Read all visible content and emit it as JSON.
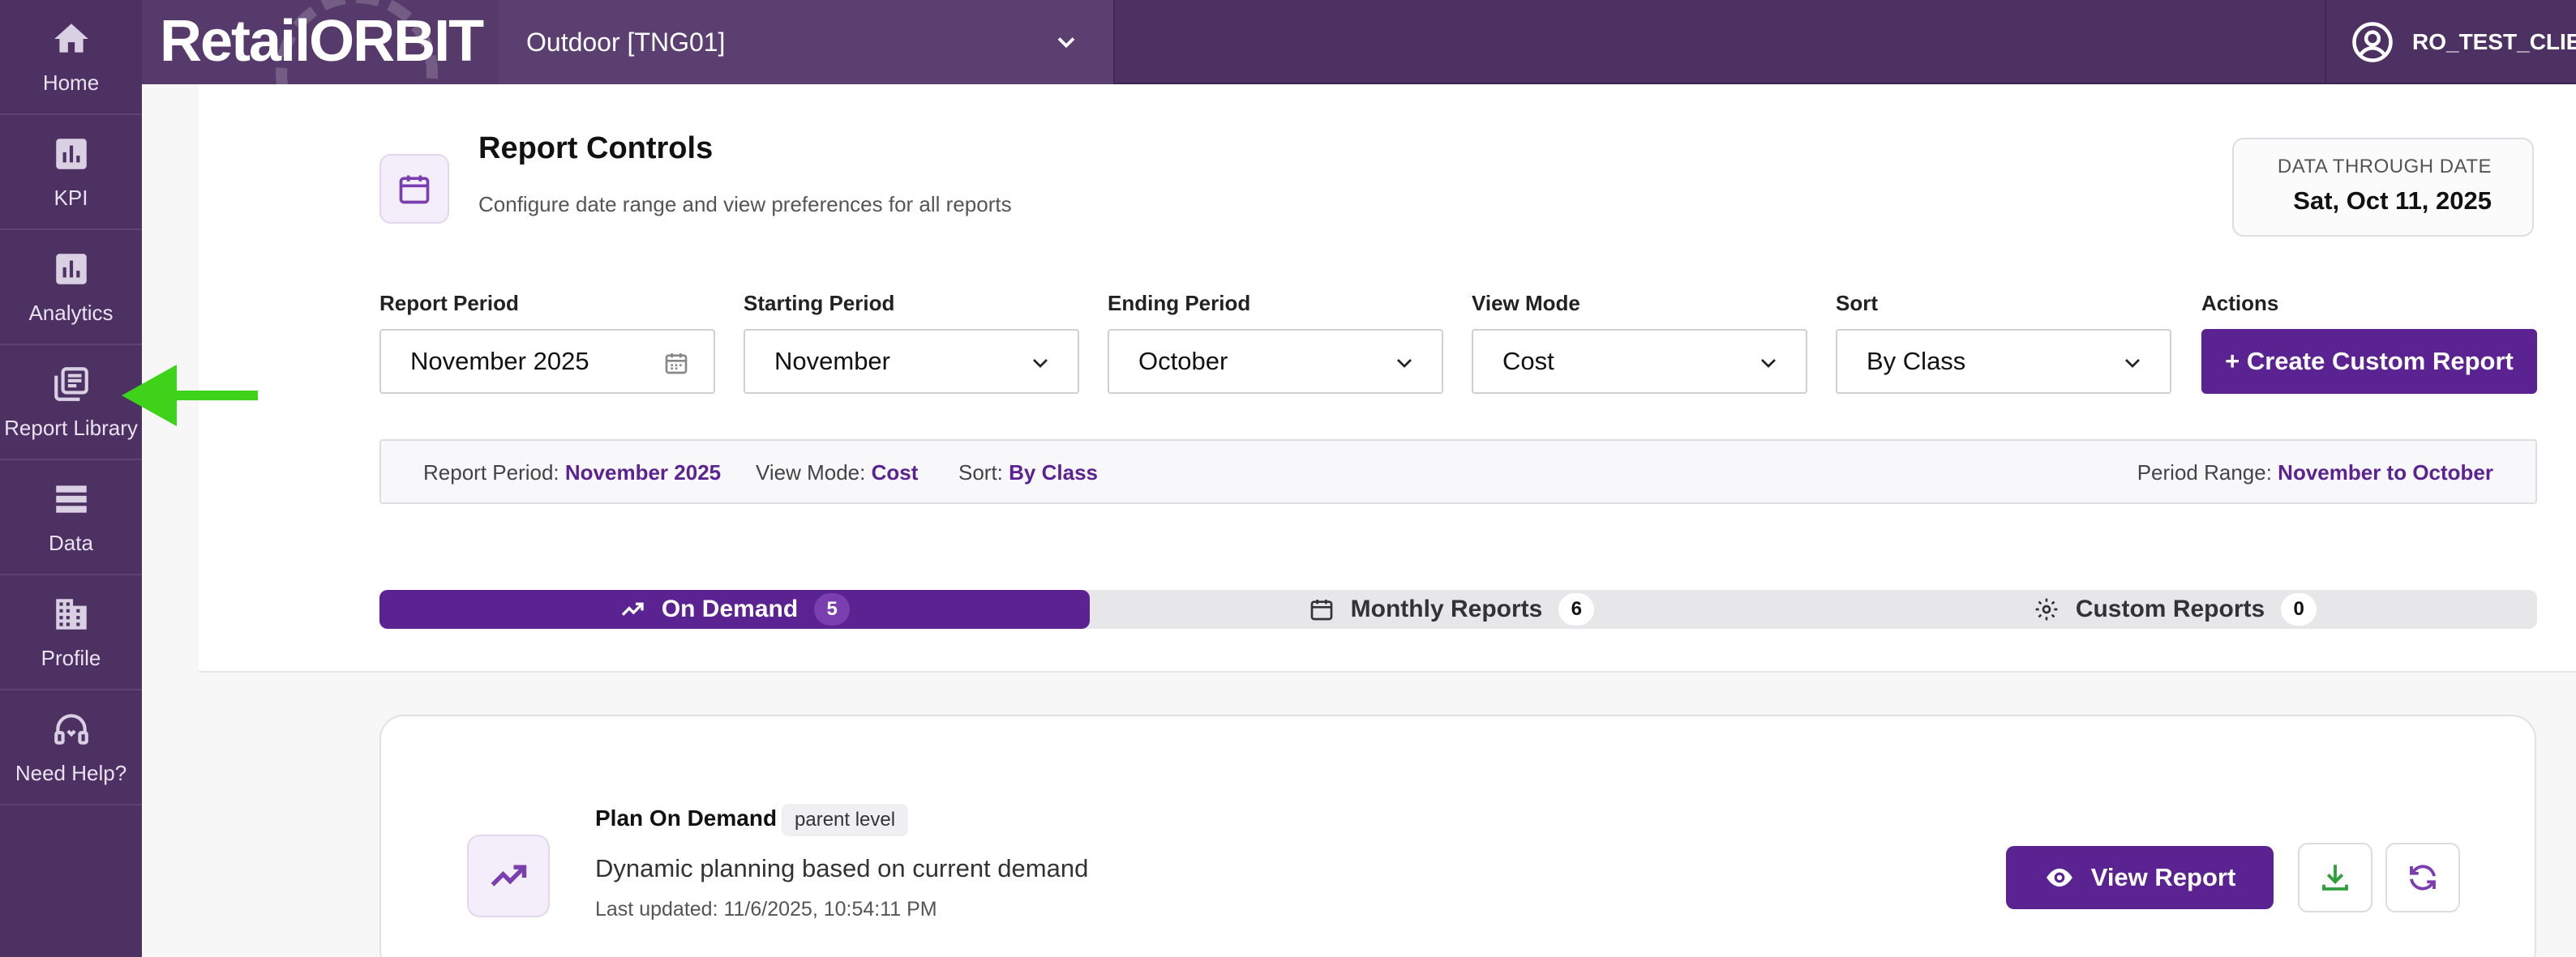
{
  "sidebar": {
    "items": [
      {
        "label": "Home",
        "icon": "home-icon"
      },
      {
        "label": "KPI",
        "icon": "bar-chart-icon"
      },
      {
        "label": "Analytics",
        "icon": "bar-chart-icon"
      },
      {
        "label": "Report Library",
        "icon": "library-icon"
      },
      {
        "label": "Data",
        "icon": "data-icon"
      },
      {
        "label": "Profile",
        "icon": "building-icon"
      },
      {
        "label": "Need Help?",
        "icon": "headset-icon"
      }
    ]
  },
  "header": {
    "logo": "RetailORBIT",
    "store": "Outdoor [TNG01]",
    "user": "RO_TEST_CLIENT"
  },
  "controls": {
    "title": "Report Controls",
    "subtitle": "Configure date range and view preferences for all reports",
    "data_through_label": "DATA THROUGH DATE",
    "data_through_value": "Sat, Oct 11, 2025",
    "fields": {
      "report_period": {
        "label": "Report Period",
        "value": "November 2025"
      },
      "starting_period": {
        "label": "Starting Period",
        "value": "November"
      },
      "ending_period": {
        "label": "Ending Period",
        "value": "October"
      },
      "view_mode": {
        "label": "View Mode",
        "value": "Cost"
      },
      "sort": {
        "label": "Sort",
        "value": "By Class"
      },
      "actions": {
        "label": "Actions",
        "button": "+ Create Custom Report"
      }
    }
  },
  "summary": {
    "report_period_label": "Report Period:",
    "report_period_value": "November 2025",
    "view_mode_label": "View Mode:",
    "view_mode_value": "Cost",
    "sort_label": "Sort:",
    "sort_value": "By Class",
    "range_label": "Period Range:",
    "range_value": "November to October"
  },
  "tabs": [
    {
      "label": "On Demand",
      "count": "5",
      "active": true
    },
    {
      "label": "Monthly Reports",
      "count": "6",
      "active": false
    },
    {
      "label": "Custom Reports",
      "count": "0",
      "active": false
    }
  ],
  "report": {
    "title": "Plan On Demand",
    "badge": "parent level",
    "description": "Dynamic planning based on current demand",
    "updated": "Last updated: 11/6/2025, 10:54:11 PM",
    "view_button": "View Report"
  },
  "colors": {
    "brand": "#5b2391",
    "sidebar": "#4d3162",
    "annotation_arrow": "#3fd21a"
  }
}
